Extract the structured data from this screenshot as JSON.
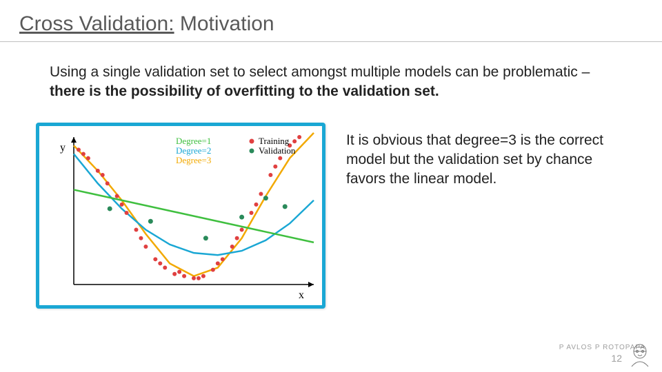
{
  "title_underlined": "Cross Validation:",
  "title_rest": " Motivation",
  "body_plain": "Using a single validation set to select amongst multiple models can be problematic – ",
  "body_bold": "there is the possibility of overfitting to the validation set.",
  "caption": "It is obvious that degree=3 is the correct model but the validation set by chance favors the linear model.",
  "footer_author": "P AVLOS P ROTOPAPA",
  "footer_page": "12",
  "chart_data": {
    "type": "scatter_with_fits",
    "xlabel": "x",
    "ylabel": "y",
    "legend_curves": [
      {
        "name": "Degree=1",
        "color": "#3fbf3f"
      },
      {
        "name": "Degree=2",
        "color": "#1aa7d4"
      },
      {
        "name": "Degree=3",
        "color": "#f2a900"
      }
    ],
    "legend_points": [
      {
        "name": "Training",
        "color": "#e04040"
      },
      {
        "name": "Validation",
        "color": "#2a8a5a"
      }
    ],
    "x_range": [
      0,
      10
    ],
    "y_range": [
      -40,
      30
    ],
    "training": [
      {
        "x": 0.2,
        "y": 24
      },
      {
        "x": 0.6,
        "y": 20
      },
      {
        "x": 1.0,
        "y": 14
      },
      {
        "x": 1.4,
        "y": 8
      },
      {
        "x": 1.8,
        "y": 2
      },
      {
        "x": 2.2,
        "y": -6
      },
      {
        "x": 2.6,
        "y": -14
      },
      {
        "x": 3.0,
        "y": -22
      },
      {
        "x": 3.4,
        "y": -28
      },
      {
        "x": 3.8,
        "y": -32
      },
      {
        "x": 4.2,
        "y": -35
      },
      {
        "x": 4.6,
        "y": -36
      },
      {
        "x": 5.0,
        "y": -37
      },
      {
        "x": 5.4,
        "y": -36
      },
      {
        "x": 5.8,
        "y": -33
      },
      {
        "x": 6.2,
        "y": -28
      },
      {
        "x": 6.6,
        "y": -22
      },
      {
        "x": 7.0,
        "y": -14
      },
      {
        "x": 7.4,
        "y": -6
      },
      {
        "x": 7.8,
        "y": 3
      },
      {
        "x": 8.2,
        "y": 12
      },
      {
        "x": 8.6,
        "y": 20
      },
      {
        "x": 9.0,
        "y": 26
      },
      {
        "x": 9.4,
        "y": 30
      },
      {
        "x": 0.4,
        "y": 22
      },
      {
        "x": 1.2,
        "y": 12
      },
      {
        "x": 2.0,
        "y": -2
      },
      {
        "x": 2.8,
        "y": -18
      },
      {
        "x": 3.6,
        "y": -30
      },
      {
        "x": 4.4,
        "y": -34
      },
      {
        "x": 5.2,
        "y": -37
      },
      {
        "x": 6.0,
        "y": -30
      },
      {
        "x": 6.8,
        "y": -18
      },
      {
        "x": 7.6,
        "y": -2
      },
      {
        "x": 8.4,
        "y": 16
      },
      {
        "x": 9.2,
        "y": 28
      }
    ],
    "validation": [
      {
        "x": 1.5,
        "y": -4
      },
      {
        "x": 3.2,
        "y": -10
      },
      {
        "x": 5.5,
        "y": -18
      },
      {
        "x": 7.0,
        "y": -8
      },
      {
        "x": 8.0,
        "y": 1
      },
      {
        "x": 8.8,
        "y": -3
      }
    ],
    "fits": {
      "degree1": [
        {
          "x": 0,
          "y": 5
        },
        {
          "x": 10,
          "y": -20
        }
      ],
      "degree2": [
        {
          "x": 0,
          "y": 22
        },
        {
          "x": 1,
          "y": 8
        },
        {
          "x": 2,
          "y": -4
        },
        {
          "x": 3,
          "y": -14
        },
        {
          "x": 4,
          "y": -21
        },
        {
          "x": 5,
          "y": -25
        },
        {
          "x": 6,
          "y": -26
        },
        {
          "x": 7,
          "y": -24
        },
        {
          "x": 8,
          "y": -19
        },
        {
          "x": 9,
          "y": -11
        },
        {
          "x": 10,
          "y": 0
        }
      ],
      "degree3": [
        {
          "x": 0,
          "y": 26
        },
        {
          "x": 1,
          "y": 14
        },
        {
          "x": 2,
          "y": 0
        },
        {
          "x": 3,
          "y": -16
        },
        {
          "x": 4,
          "y": -30
        },
        {
          "x": 5,
          "y": -36
        },
        {
          "x": 6,
          "y": -32
        },
        {
          "x": 7,
          "y": -18
        },
        {
          "x": 8,
          "y": 2
        },
        {
          "x": 9,
          "y": 20
        },
        {
          "x": 10,
          "y": 32
        }
      ]
    }
  }
}
